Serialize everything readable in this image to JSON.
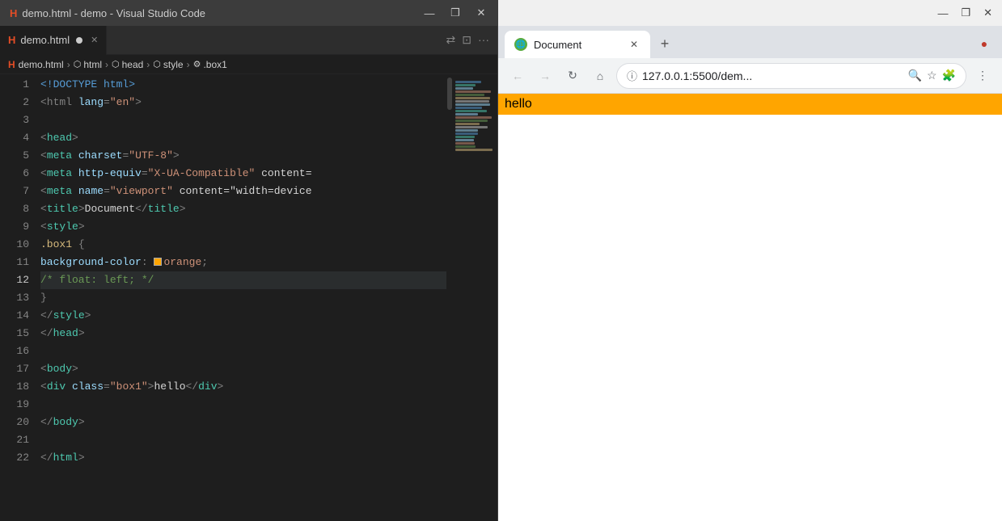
{
  "vscode": {
    "titlebar": {
      "title": "demo.html - demo - Visual Studio Code",
      "minimize": "—",
      "maximize": "❒",
      "close": "✕"
    },
    "tab": {
      "label": "demo.html",
      "dirty": true,
      "close": "✕"
    },
    "tabbar_actions": [
      "⇄",
      "⊡",
      "···"
    ],
    "breadcrumb": {
      "filename": "demo.html",
      "path": [
        "html",
        "head",
        "style",
        ".box1"
      ]
    },
    "lines": [
      {
        "num": "1",
        "tokens": [
          {
            "t": "doctype",
            "v": "<!DOCTYPE html>"
          }
        ]
      },
      {
        "num": "2",
        "tokens": [
          {
            "t": "tag",
            "v": "<html "
          },
          {
            "t": "attr",
            "v": "lang"
          },
          {
            "t": "punct",
            "v": "="
          },
          {
            "t": "string",
            "v": "\"en\""
          },
          {
            "t": "tag",
            "v": ">"
          }
        ]
      },
      {
        "num": "3",
        "tokens": []
      },
      {
        "num": "4",
        "tokens": [
          {
            "t": "tag",
            "v": "<"
          },
          {
            "t": "tagname",
            "v": "head"
          },
          {
            "t": "tag",
            "v": ">"
          }
        ]
      },
      {
        "num": "5",
        "tokens": [
          {
            "t": "tag",
            "v": "<"
          },
          {
            "t": "tagname",
            "v": "meta"
          },
          {
            "t": "text",
            "v": " "
          },
          {
            "t": "attr",
            "v": "charset"
          },
          {
            "t": "punct",
            "v": "="
          },
          {
            "t": "string",
            "v": "\"UTF-8\""
          },
          {
            "t": "tag",
            "v": ">"
          }
        ]
      },
      {
        "num": "6",
        "tokens": [
          {
            "t": "tag",
            "v": "<"
          },
          {
            "t": "tagname",
            "v": "meta"
          },
          {
            "t": "text",
            "v": " "
          },
          {
            "t": "attr",
            "v": "http-equiv"
          },
          {
            "t": "punct",
            "v": "="
          },
          {
            "t": "string",
            "v": "\"X-UA-Compatible\""
          },
          {
            "t": "text",
            "v": " content="
          }
        ]
      },
      {
        "num": "7",
        "tokens": [
          {
            "t": "tag",
            "v": "<"
          },
          {
            "t": "tagname",
            "v": "meta"
          },
          {
            "t": "text",
            "v": " "
          },
          {
            "t": "attr",
            "v": "name"
          },
          {
            "t": "punct",
            "v": "="
          },
          {
            "t": "string",
            "v": "\"viewport\""
          },
          {
            "t": "text",
            "v": " content=\"width=device"
          }
        ]
      },
      {
        "num": "8",
        "tokens": [
          {
            "t": "tag",
            "v": "<"
          },
          {
            "t": "tagname",
            "v": "title"
          },
          {
            "t": "tag",
            "v": ">"
          },
          {
            "t": "text",
            "v": "Document"
          },
          {
            "t": "tag",
            "v": "</"
          },
          {
            "t": "tagname",
            "v": "title"
          },
          {
            "t": "tag",
            "v": ">"
          }
        ]
      },
      {
        "num": "9",
        "tokens": [
          {
            "t": "tag",
            "v": "<"
          },
          {
            "t": "tagname",
            "v": "style"
          },
          {
            "t": "tag",
            "v": ">"
          }
        ]
      },
      {
        "num": "10",
        "tokens": [
          {
            "t": "class",
            "v": ".box1"
          },
          {
            "t": "text",
            "v": " "
          },
          {
            "t": "punct",
            "v": "{"
          }
        ]
      },
      {
        "num": "11",
        "tokens": [
          {
            "t": "prop",
            "v": "background-color"
          },
          {
            "t": "punct",
            "v": ":"
          },
          {
            "t": "text",
            "v": " "
          },
          {
            "t": "swatch",
            "v": ""
          },
          {
            "t": "value",
            "v": "orange"
          },
          {
            "t": "punct",
            "v": ";"
          }
        ]
      },
      {
        "num": "12",
        "tokens": [
          {
            "t": "comment",
            "v": "/* float: left; */"
          }
        ],
        "highlighted": true
      },
      {
        "num": "13",
        "tokens": [
          {
            "t": "punct",
            "v": "}"
          }
        ]
      },
      {
        "num": "14",
        "tokens": [
          {
            "t": "tag",
            "v": "</"
          },
          {
            "t": "tagname",
            "v": "style"
          },
          {
            "t": "tag",
            "v": ">"
          }
        ]
      },
      {
        "num": "15",
        "tokens": [
          {
            "t": "tag",
            "v": "</"
          },
          {
            "t": "tagname",
            "v": "head"
          },
          {
            "t": "tag",
            "v": ">"
          }
        ]
      },
      {
        "num": "16",
        "tokens": []
      },
      {
        "num": "17",
        "tokens": [
          {
            "t": "tag",
            "v": "<"
          },
          {
            "t": "tagname",
            "v": "body"
          },
          {
            "t": "tag",
            "v": ">"
          }
        ]
      },
      {
        "num": "18",
        "tokens": [
          {
            "t": "tag",
            "v": "<"
          },
          {
            "t": "tagname",
            "v": "div"
          },
          {
            "t": "text",
            "v": " "
          },
          {
            "t": "attr",
            "v": "class"
          },
          {
            "t": "punct",
            "v": "="
          },
          {
            "t": "string",
            "v": "\"box1\""
          },
          {
            "t": "tag",
            "v": ">"
          },
          {
            "t": "text",
            "v": "hello"
          },
          {
            "t": "tag",
            "v": "</"
          },
          {
            "t": "tagname",
            "v": "div"
          },
          {
            "t": "tag",
            "v": ">"
          }
        ]
      },
      {
        "num": "19",
        "tokens": []
      },
      {
        "num": "20",
        "tokens": [
          {
            "t": "tag",
            "v": "</"
          },
          {
            "t": "tagname",
            "v": "body"
          },
          {
            "t": "tag",
            "v": ">"
          }
        ]
      },
      {
        "num": "21",
        "tokens": []
      },
      {
        "num": "22",
        "tokens": [
          {
            "t": "tag",
            "v": "</"
          },
          {
            "t": "tagname",
            "v": "html"
          },
          {
            "t": "tag",
            "v": ">"
          }
        ]
      }
    ]
  },
  "browser": {
    "titlebar": {
      "minimize": "—",
      "maximize": "❒",
      "close": "✕"
    },
    "tab": {
      "title": "Document",
      "close": "✕"
    },
    "new_tab_btn": "+",
    "extra_btn": "●",
    "toolbar": {
      "back": "←",
      "forward": "→",
      "reload": "↻",
      "home": "⌂",
      "lock_icon": "ⓘ",
      "url": "127.0.0.1:5500/dem...",
      "search_icon": "🔍",
      "star_icon": "☆",
      "extensions_icon": "🧩",
      "more_icon": "⋮"
    },
    "content": {
      "hello_text": "hello"
    }
  }
}
